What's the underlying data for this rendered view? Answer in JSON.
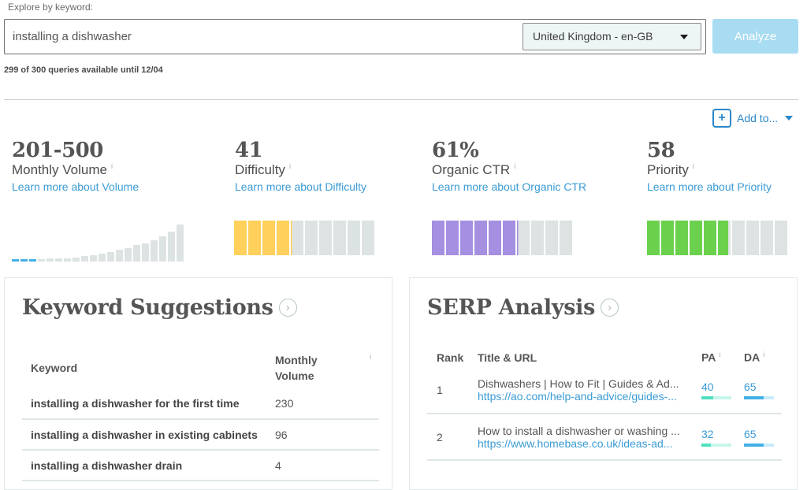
{
  "search": {
    "label": "Explore by keyword:",
    "value": "installing a dishwasher",
    "locale": "United Kingdom - en-GB",
    "analyze_label": "Analyze",
    "quota": "299 of 300 queries available until 12/04"
  },
  "add_to": {
    "label": "Add to..."
  },
  "metrics": [
    {
      "value": "201-500",
      "label": "Monthly Volume",
      "link": "Learn more about Volume",
      "color": "#42b0e6"
    },
    {
      "value": "41",
      "label": "Difficulty",
      "link": "Learn more about Difficulty",
      "score": 41,
      "color": "#ffd05c"
    },
    {
      "value": "61%",
      "label": "Organic CTR",
      "link": "Learn more about Organic CTR",
      "score": 61,
      "color": "#a48fe0"
    },
    {
      "value": "58",
      "label": "Priority",
      "link": "Learn more about Priority",
      "score": 58,
      "color": "#6bd14d"
    }
  ],
  "info_glyph": "i",
  "volume_bars": {
    "count": 20,
    "highlighted": 3,
    "relative_heights": [
      0.04,
      0.04,
      0.06,
      0.05,
      0.07,
      0.07,
      0.08,
      0.1,
      0.14,
      0.16,
      0.2,
      0.24,
      0.28,
      0.33,
      0.4,
      0.45,
      0.52,
      0.62,
      0.73,
      0.9
    ]
  },
  "keyword_suggestions": {
    "title": "Keyword Suggestions",
    "columns": [
      "Keyword",
      "Monthly Volume"
    ],
    "rows": [
      {
        "keyword": "installing a dishwasher for the first time",
        "volume": "230"
      },
      {
        "keyword": "installing a dishwasher in existing cabinets",
        "volume": "96"
      },
      {
        "keyword": "installing a dishwasher drain",
        "volume": "4"
      }
    ]
  },
  "serp_analysis": {
    "title": "SERP Analysis",
    "columns": [
      "Rank",
      "Title & URL",
      "PA",
      "DA"
    ],
    "rows": [
      {
        "rank": "1",
        "title": "Dishwashers | How to Fit | Guides & Ad...",
        "url": "https://ao.com/help-and-advice/guides-...",
        "pa": 40,
        "da": 65
      },
      {
        "rank": "2",
        "title": "How to install a dishwasher or washing ...",
        "url": "https://www.homebase.co.uk/ideas-ad...",
        "pa": 32,
        "da": 65
      }
    ],
    "pa_color": "#4fe0c0",
    "pa_track": "#c6f6ea",
    "da_color": "#42b0e6",
    "da_track": "#c8ebfa"
  }
}
